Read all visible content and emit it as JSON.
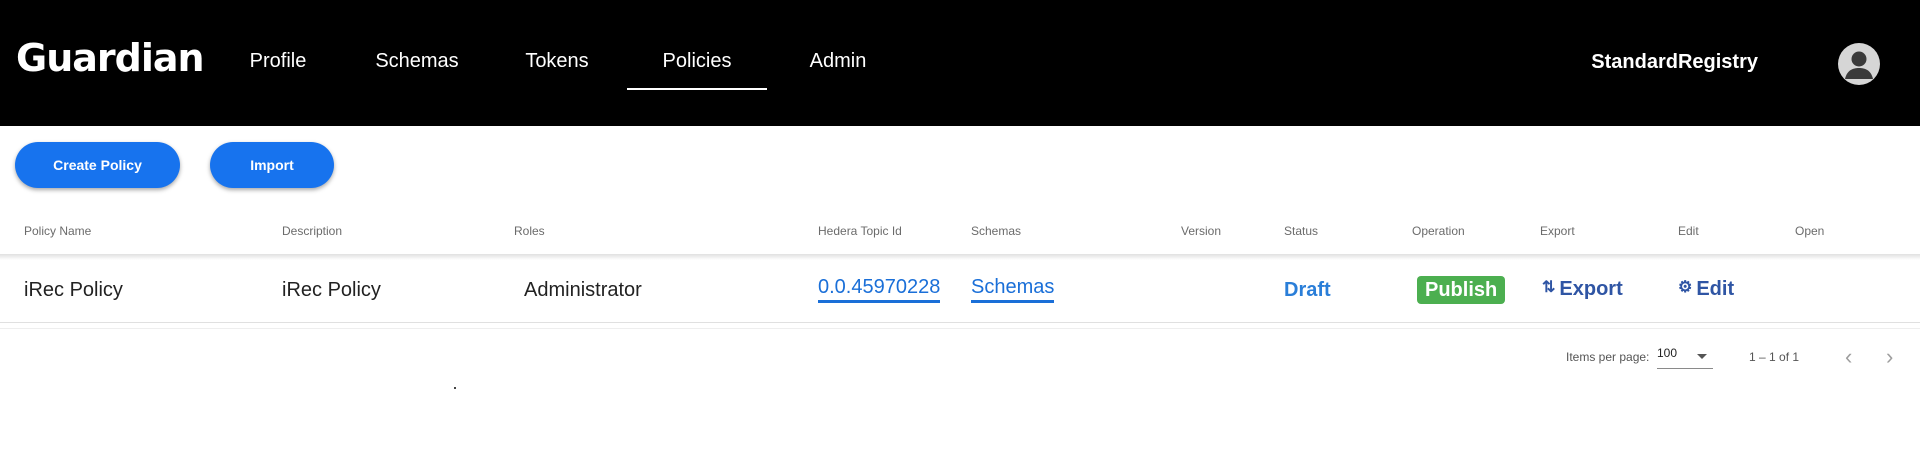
{
  "header": {
    "brand": "Guardian",
    "nav": [
      {
        "label": "Profile"
      },
      {
        "label": "Schemas"
      },
      {
        "label": "Tokens"
      },
      {
        "label": "Policies",
        "active": true
      },
      {
        "label": "Admin"
      }
    ],
    "user_name": "StandardRegistry"
  },
  "toolbar": {
    "create_label": "Create Policy",
    "import_label": "Import"
  },
  "table": {
    "columns": [
      "Policy Name",
      "Description",
      "Roles",
      "Hedera Topic Id",
      "Schemas",
      "Version",
      "Status",
      "Operation",
      "Export",
      "Edit",
      "Open"
    ],
    "rows": [
      {
        "policy_name": "iRec Policy",
        "description": "iRec Policy",
        "roles": "Administrator",
        "topic_id": "0.0.45970228",
        "schemas": "Schemas",
        "version": "",
        "status": "Draft",
        "operation": "Publish",
        "export": "Export",
        "edit": "Edit",
        "open": ""
      }
    ]
  },
  "paginator": {
    "items_per_page_label": "Items per page:",
    "items_per_page_value": "100",
    "range": "1 – 1 of 1"
  },
  "colors": {
    "header_bg": "#000000",
    "primary_button": "#1773ee",
    "link": "#1a6fd8",
    "publish_badge": "#4caf50",
    "action": "#2f55a4"
  },
  "icons": {
    "export": "swap-vertical-icon",
    "edit": "gear-icon",
    "avatar": "account-circle-icon",
    "prev": "chevron-left-icon",
    "next": "chevron-right-icon"
  }
}
